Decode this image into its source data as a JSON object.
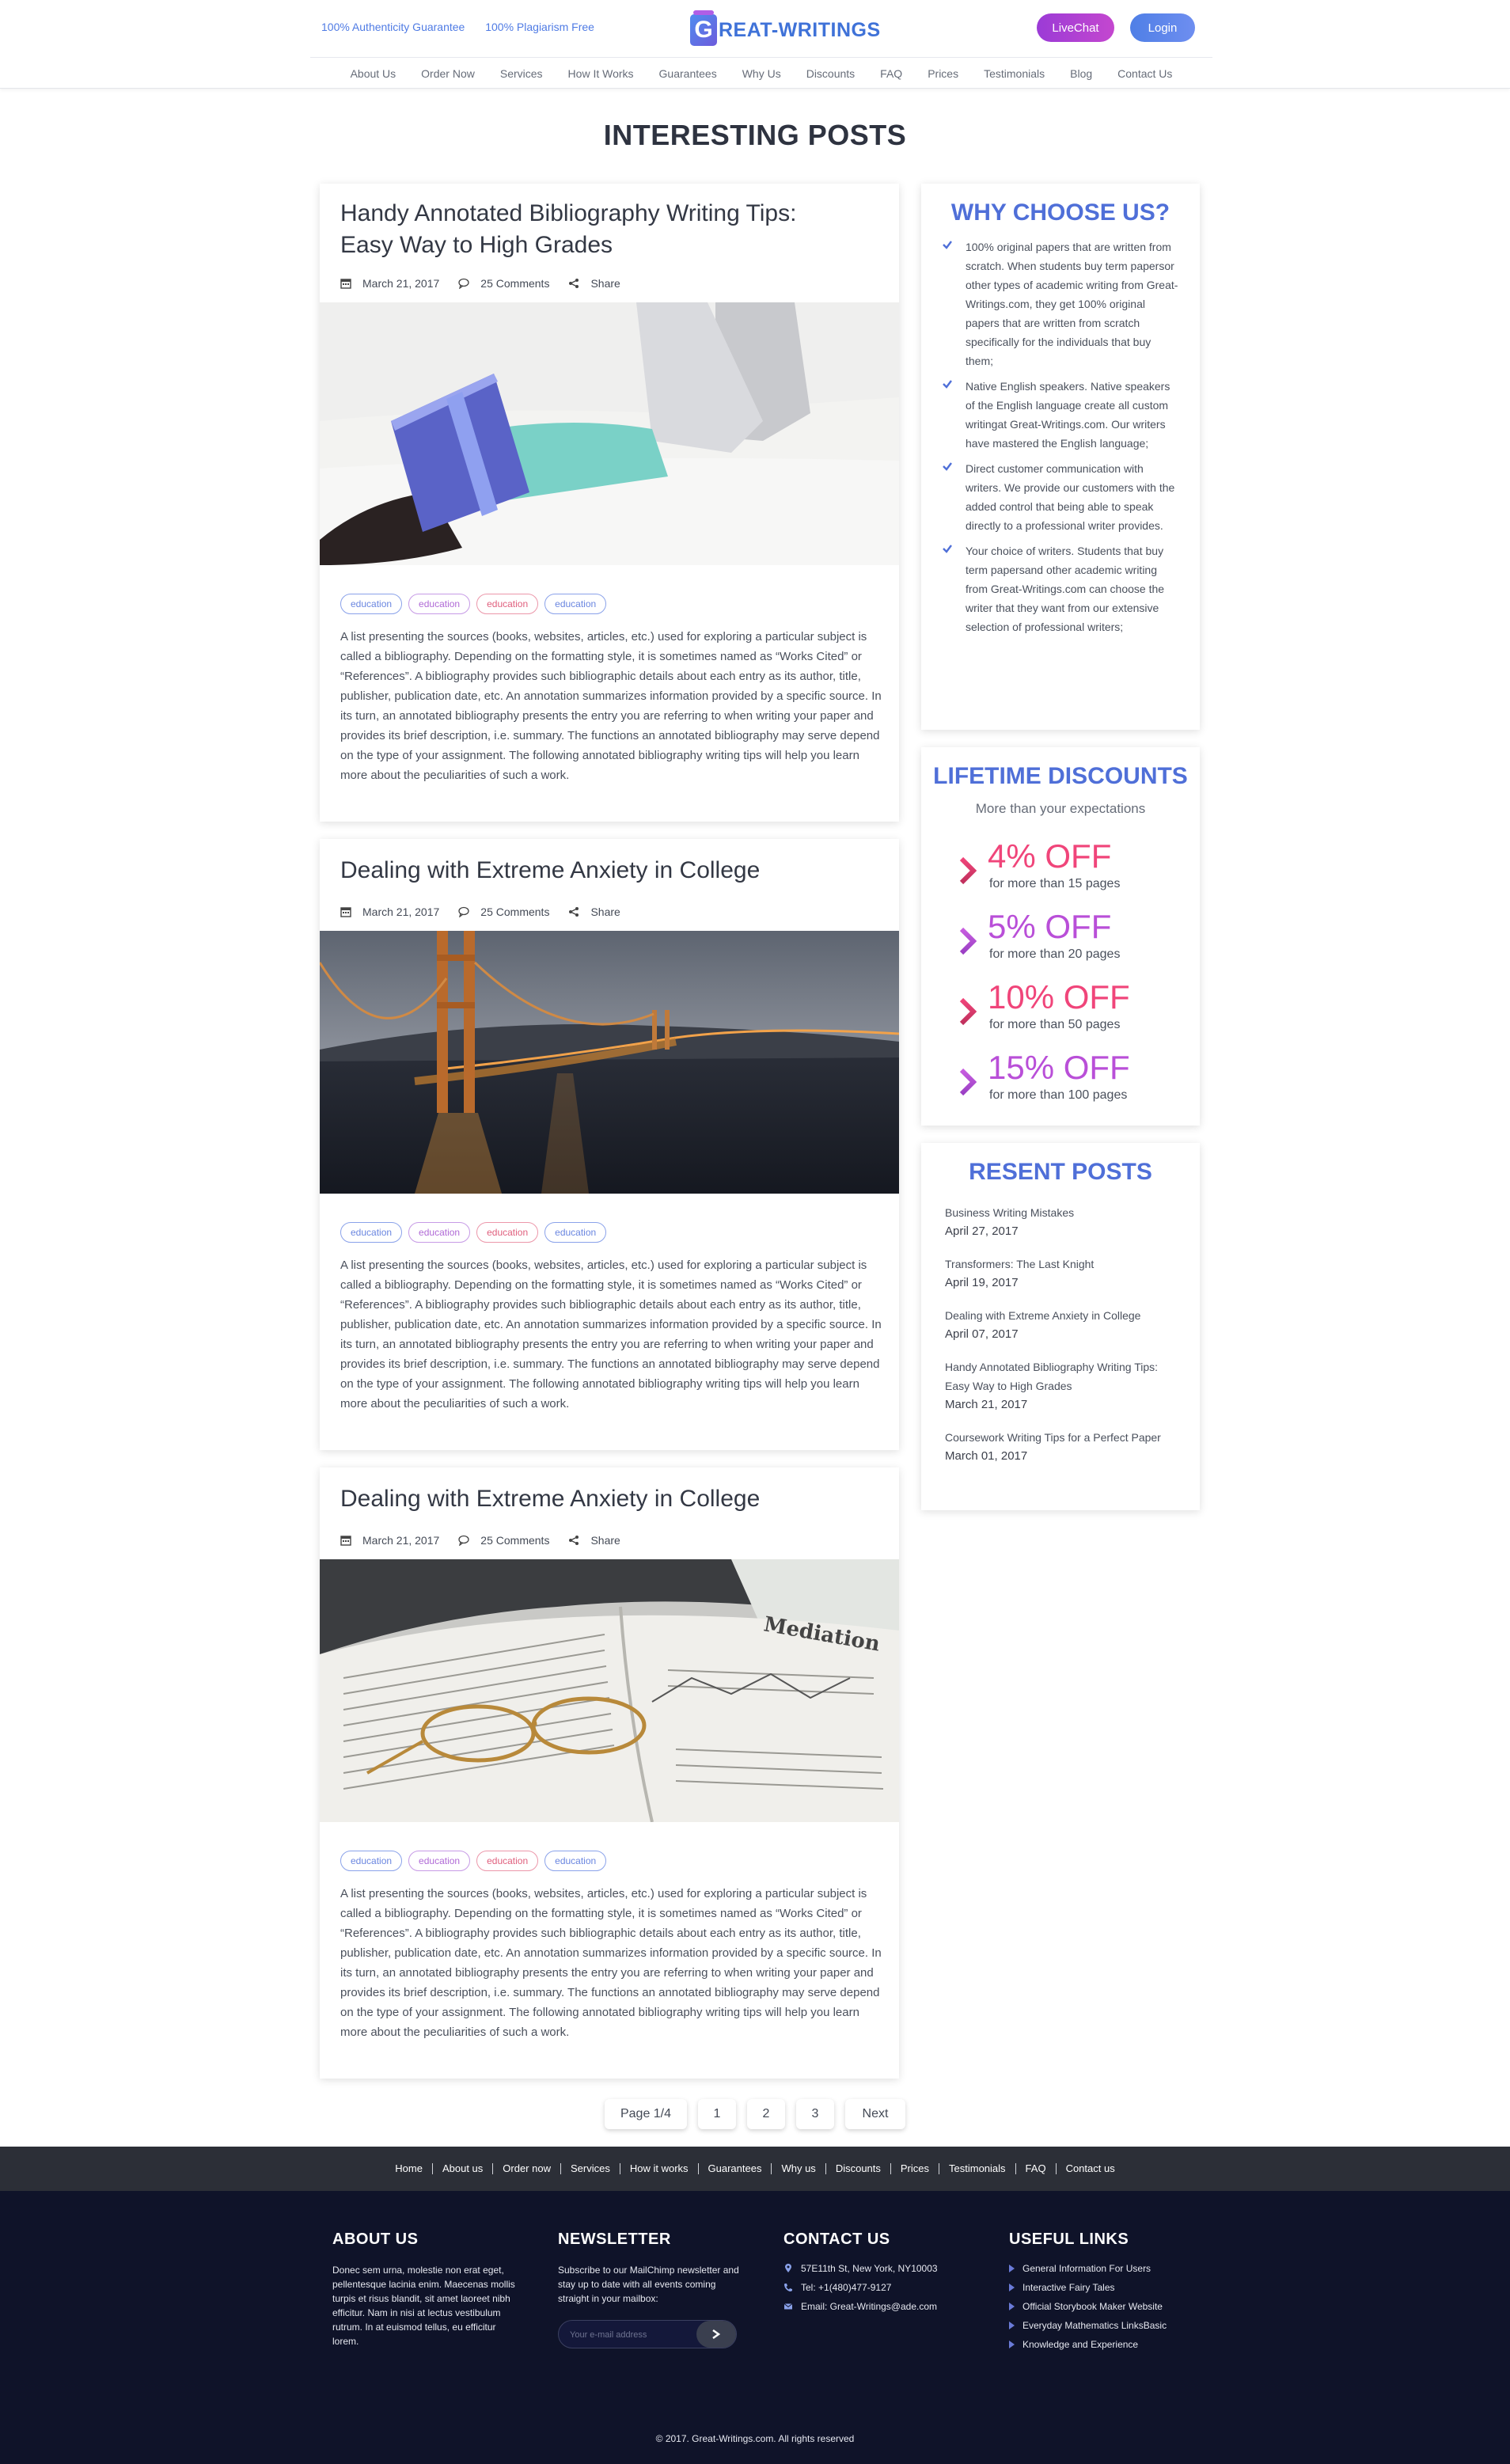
{
  "header": {
    "badges": [
      "100% Authenticity Guarantee",
      "100% Plagiarism Free"
    ],
    "logo_text": "REAT-WRITINGS",
    "logo_letter": "G",
    "live_chat": "LiveChat",
    "login": "Login",
    "nav": [
      "About Us",
      "Order Now",
      "Services",
      "How It Works",
      "Guarantees",
      "Why Us",
      "Discounts",
      "FAQ",
      "Prices",
      "Testimonials",
      "Blog",
      "Contact Us"
    ]
  },
  "page_title": "INTERESTING POSTS",
  "posts": [
    {
      "title": "Handy Annotated Bibliography Writing Tips: Easy Way to High Grades",
      "date": "March 21, 2017",
      "comments": "25 Comments",
      "share": "Share",
      "image": "woman-reading-book-photo",
      "tags": [
        "education",
        "education",
        "education",
        "education"
      ],
      "excerpt": "A list presenting the sources (books, websites, articles, etc.) used for exploring a particular subject is called a bibliography. Depending on the formatting style, it is sometimes named as “Works Cited” or “References”. A bibliography provides such bibliographic details about each entry as its author, title, publisher, publication date, etc. An annotation summarizes information provided by a specific source. In its turn, an annotated bibliography presents the entry you are referring to when writing your paper and provides its brief description, i.e. summary. The functions an annotated bibliography may serve depend on the type of your assignment. The following annotated bibliography writing tips will help you learn more about the peculiarities of such a work."
    },
    {
      "title": "Dealing with Extreme Anxiety in College",
      "date": "March 21, 2017",
      "comments": "25 Comments",
      "share": "Share",
      "image": "bridge-at-night-photo",
      "tags": [
        "education",
        "education",
        "education",
        "education"
      ],
      "excerpt": "A list presenting the sources (books, websites, articles, etc.) used for exploring a particular subject is called a bibliography. Depending on the formatting style, it is sometimes named as “Works Cited” or “References”. A bibliography provides such bibliographic details about each entry as its author, title, publisher, publication date, etc. An annotation summarizes information provided by a specific source. In its turn, an annotated bibliography presents the entry you are referring to when writing your paper and provides its brief description, i.e. summary. The functions an annotated bibliography may serve depend on the type of your assignment. The following annotated bibliography writing tips will help you learn more about the peculiarities of such a work."
    },
    {
      "title": "Dealing with Extreme Anxiety in College",
      "date": "March 21, 2017",
      "comments": "25 Comments",
      "share": "Share",
      "image": "open-book-glasses-photo",
      "tags": [
        "education",
        "education",
        "education",
        "education"
      ],
      "excerpt": "A list presenting the sources (books, websites, articles, etc.) used for exploring a particular subject is called a bibliography. Depending on the formatting style, it is sometimes named as “Works Cited” or “References”. A bibliography provides such bibliographic details about each entry as its author, title, publisher, publication date, etc. An annotation summarizes information provided by a specific source. In its turn, an annotated bibliography presents the entry you are referring to when writing your paper and provides its brief description, i.e. summary. The functions an annotated bibliography may serve depend on the type of your assignment. The following annotated bibliography writing tips will help you learn more about the peculiarities of such a work."
    }
  ],
  "why_choose": {
    "title": "WHY CHOOSE US?",
    "items": [
      "100% original papers that are written from scratch. When students buy term papersor other types of academic writing from Great-Writings.com, they get 100% original papers that are written from scratch specifically for the individuals that buy them;",
      "Native English speakers. Native speakers of the English language create all custom writingat Great-Writings.com. Our writers have mastered the English language;",
      "Direct customer communication with writers. We provide our customers with the added control that being able to speak directly to a professional writer provides.",
      "Your choice of writers. Students that buy term papersand other academic writing from Great-Writings.com can choose the writer that they want from our extensive selection of professional writers;"
    ]
  },
  "discounts": {
    "title": "LIFETIME DISCOUNTS",
    "subtitle": "More than your expectations",
    "items": [
      {
        "pct": "4% OFF",
        "label": "for more than 15 pages",
        "color": "#f0457a"
      },
      {
        "pct": "5% OFF",
        "label": "for more than 20 pages",
        "color": "#b94fd8"
      },
      {
        "pct": "10% OFF",
        "label": "for more than 50 pages",
        "color": "#f0457a"
      },
      {
        "pct": "15% OFF",
        "label": "for more than 100 pages",
        "color": "#b94fd8"
      }
    ]
  },
  "recent": {
    "title": "RESENT POSTS",
    "items": [
      {
        "title": "Business Writing Mistakes",
        "date": "April 27, 2017"
      },
      {
        "title": "Transformers: The Last Knight",
        "date": "April 19, 2017"
      },
      {
        "title": "Dealing with Extreme Anxiety in College",
        "date": "April 07, 2017"
      },
      {
        "title": "Handy Annotated Bibliography Writing Tips: Easy Way to High Grades",
        "date": "March 21, 2017"
      },
      {
        "title": "Coursework Writing Tips for a Perfect Paper",
        "date": "March 01, 2017"
      }
    ]
  },
  "pagination": {
    "current": "Page 1/4",
    "pages": [
      "1",
      "2",
      "3"
    ],
    "next": "Next"
  },
  "footer_nav": [
    "Home",
    "About us",
    "Order now",
    "Services",
    "How it works",
    "Guarantees",
    "Why us",
    "Discounts",
    "Prices",
    "Testimonials",
    "FAQ",
    "Contact us"
  ],
  "footer": {
    "about": {
      "title": "ABOUT US",
      "text": "Donec sem urna, molestie non erat eget, pellentesque lacinia enim. Maecenas mollis turpis et risus blandit, sit amet laoreet nibh efficitur. Nam in nisi at lectus vestibulum rutrum. In at euismod tellus, eu efficitur lorem."
    },
    "newsletter": {
      "title": "NEWSLETTER",
      "text": "Subscribe to our MailChimp newsletter and stay up to date with all events coming straight in your mailbox:",
      "placeholder": "Your e-mail address"
    },
    "contact": {
      "title": "CONTACT US",
      "address": "57E11th St, New York, NY10003",
      "phone": "Tel: +1(480)477-9127",
      "email": "Email: Great-Writings@ade.com"
    },
    "links": {
      "title": "USEFUL LINKS",
      "items": [
        "General Information For Users",
        "Interactive Fairy Tales",
        "Official Storybook Maker Website",
        "Everyday Mathematics LinksBasic",
        "Knowledge and Experience"
      ]
    },
    "copyright": "© 2017. Great-Writings.com. All rights reserved"
  }
}
